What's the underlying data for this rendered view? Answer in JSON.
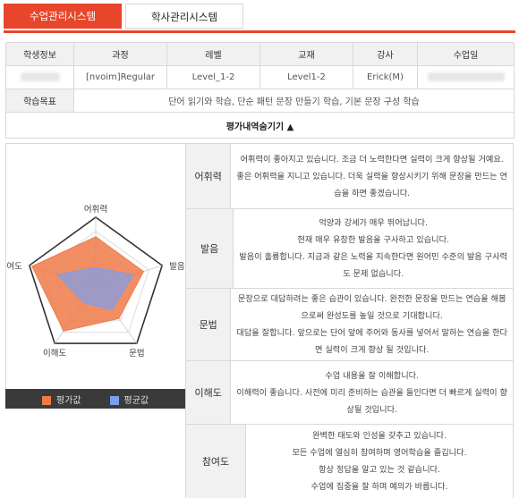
{
  "tabs": {
    "active": "수업관리시스템",
    "inactive": "학사관리시스템"
  },
  "info": {
    "headers": [
      "학생정보",
      "과정",
      "레벨",
      "교재",
      "강사",
      "수업일"
    ],
    "row": {
      "course": "[nvoim]Regular",
      "level": "Level_1-2",
      "book": "Level1-2",
      "teacher": "Erick(M)"
    },
    "goal_label": "학습목표",
    "goal_text": "단어 읽기와 학습, 단순 패턴 문장 만들기 학습, 기본 문장 구성 학습",
    "toggle_label": "평가내역숨기기 ▲"
  },
  "colors": {
    "accent": "#e8462b",
    "eval": "#f07a48",
    "avg": "#7b9ef0"
  },
  "chart_data": {
    "type": "radar",
    "axes": [
      "어휘력",
      "발음",
      "문법",
      "이해도",
      "참여도"
    ],
    "max": 5,
    "series": [
      {
        "name": "평가값",
        "values": [
          3.6,
          3.6,
          2.8,
          3.9,
          4.8
        ]
      },
      {
        "name": "평균값",
        "values": [
          1.4,
          2.8,
          2.0,
          1.4,
          2.9
        ]
      }
    ],
    "legend": [
      "평가값",
      "평균값"
    ]
  },
  "eval": [
    {
      "label": "어휘력",
      "lines": [
        "어휘력이 좋아지고 있습니다. 조금 더 노력한다면 실력이 크게 향상될 거예요.",
        "좋은 어휘력을 지니고 있습니다. 더욱 실력을 향상시키기 위해 문장을 만드는 연",
        "습을 하면 좋겠습니다."
      ]
    },
    {
      "label": "발음",
      "lines": [
        "억양과 강세가 매우 뛰어납니다.",
        "현재 매우 유창한 발음을 구사하고 있습니다.",
        "발음이 훌륭합니다. 지금과 같은 노력을 지속한다면 원어민 수준의 발음 구사력",
        "도 문제 없습니다."
      ]
    },
    {
      "label": "문법",
      "lines": [
        "문장으로 대답하려는 좋은 습관이 있습니다. 완전한 문장을 만드는 연습을 해봅",
        "으로써 완성도를 높일 것으로 기대합니다.",
        "대답을 잘합니다. 앞으로는 단어 앞에 주어와 동사를 넣어서 말하는 연습을 한다",
        "면 실력이 크게 향상 될 것입니다."
      ]
    },
    {
      "label": "이해도",
      "lines": [
        "수업 내용을 잘 이해합니다.",
        "이해력이 좋습니다. 사전에 미리 준비하는 습관을 들인다면 더 빠르게 실력이 향",
        "상될 것입니다."
      ]
    },
    {
      "label": "참여도",
      "lines": [
        "완벽한 태도와 인성을 갖추고 있습니다.",
        "모든 수업에 열심히 참여하며 영어학습을 즐깁니다.",
        "항상 정답을 알고 있는 것 같습니다.",
        "수업에 집중을 잘 하며 예의가 바릅니다."
      ]
    }
  ]
}
